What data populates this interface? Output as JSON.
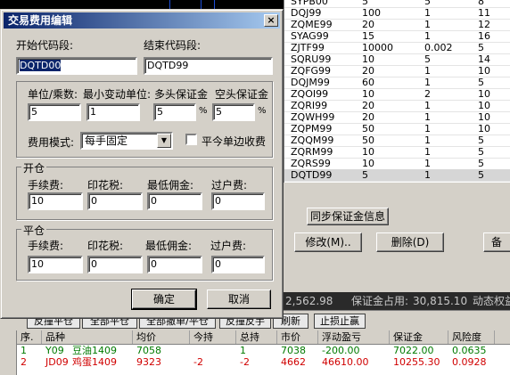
{
  "dialog": {
    "title": "交易费用编辑",
    "start_code_label": "开始代码段:",
    "end_code_label": "结束代码段:",
    "start_code_value": "DQTD00",
    "end_code_value": "DQTD99",
    "unit_label": "单位/乘数:",
    "min_tick_label": "最小变动单位:",
    "long_margin_label": "多头保证金",
    "short_margin_label": "空头保证金",
    "unit_value": "5",
    "min_tick_value": "1",
    "long_margin_value": "5",
    "short_margin_value": "5",
    "percent": "%",
    "fee_mode_label": "费用模式:",
    "fee_mode_value": "每手固定",
    "close_single_label": "平今单边收费",
    "open_group": {
      "title": "开仓",
      "fee_label": "手续费:",
      "stamp_label": "印花税:",
      "min_comm_label": "最低佣金:",
      "transfer_label": "过户费:",
      "fee_value": "10",
      "stamp_value": "0",
      "min_comm_value": "0",
      "transfer_value": "0"
    },
    "close_group": {
      "title": "平仓",
      "fee_label": "手续费:",
      "stamp_label": "印花税:",
      "min_comm_label": "最低佣金:",
      "transfer_label": "过户费:",
      "fee_value": "10",
      "stamp_value": "0",
      "min_comm_value": "0",
      "transfer_value": "0"
    },
    "ok_label": "确定",
    "cancel_label": "取消"
  },
  "fee_table": {
    "rows": [
      {
        "code": "SYPB00",
        "c1": "5",
        "c2": "5",
        "c3": "8"
      },
      {
        "code": "DQJ99",
        "c1": "100",
        "c2": "1",
        "c3": "11"
      },
      {
        "code": "ZQME99",
        "c1": "20",
        "c2": "1",
        "c3": "12"
      },
      {
        "code": "SYAG99",
        "c1": "15",
        "c2": "1",
        "c3": "16"
      },
      {
        "code": "ZJTF99",
        "c1": "10000",
        "c2": "0.002",
        "c3": "5"
      },
      {
        "code": "SQRU99",
        "c1": "10",
        "c2": "5",
        "c3": "14"
      },
      {
        "code": "ZQFG99",
        "c1": "20",
        "c2": "1",
        "c3": "10"
      },
      {
        "code": "DQJM99",
        "c1": "60",
        "c2": "1",
        "c3": "5"
      },
      {
        "code": "ZQOI99",
        "c1": "10",
        "c2": "2",
        "c3": "10"
      },
      {
        "code": "ZQRI99",
        "c1": "20",
        "c2": "1",
        "c3": "10"
      },
      {
        "code": "ZQWH99",
        "c1": "20",
        "c2": "1",
        "c3": "10"
      },
      {
        "code": "ZQPM99",
        "c1": "50",
        "c2": "1",
        "c3": "10"
      },
      {
        "code": "ZQQM99",
        "c1": "50",
        "c2": "1",
        "c3": "5"
      },
      {
        "code": "ZQRM99",
        "c1": "10",
        "c2": "1",
        "c3": "5"
      },
      {
        "code": "ZQRS99",
        "c1": "10",
        "c2": "1",
        "c3": "5"
      },
      {
        "code": "DQTD99",
        "c1": "5",
        "c2": "1",
        "c3": "5"
      }
    ]
  },
  "right_panel": {
    "sync_margin_label": "同步保证金信息",
    "modify_label": "修改(M)..",
    "delete_label": "删除(D)",
    "backup_label": "备"
  },
  "status": {
    "balance_fragment": "2,562.98",
    "margin_label": "保证金占用:",
    "margin_value": "30,815.10",
    "dynamic_label": "动态权益"
  },
  "toolbar": {
    "btn1": "反撞平仓",
    "btn2": "全部平仓",
    "btn3": "全部撤单/平仓",
    "btn4": "反撞反手",
    "refresh": "刷新",
    "stoploss": "止损止赢"
  },
  "positions": {
    "headers": [
      "序.",
      "品种",
      "均价",
      "今持",
      "总持",
      "市价",
      "浮动盈亏",
      "保证金",
      "风险度",
      ""
    ],
    "rows": [
      {
        "idx": "1",
        "code": "Y09",
        "name": "豆油1409",
        "avg": "7058",
        "today": "",
        "total": "1",
        "market": "7038",
        "pnl": "-200.00",
        "margin": "7022.00",
        "risk": "0.0635",
        "color": "#007a00"
      },
      {
        "idx": "2",
        "code": "JD09",
        "name": "鸡蛋1409",
        "avg": "9323",
        "today": "-2",
        "total": "-2",
        "market": "4662",
        "pnl": "46610.00",
        "margin": "10255.30",
        "risk": "0.0928",
        "color": "#d00000"
      }
    ]
  }
}
